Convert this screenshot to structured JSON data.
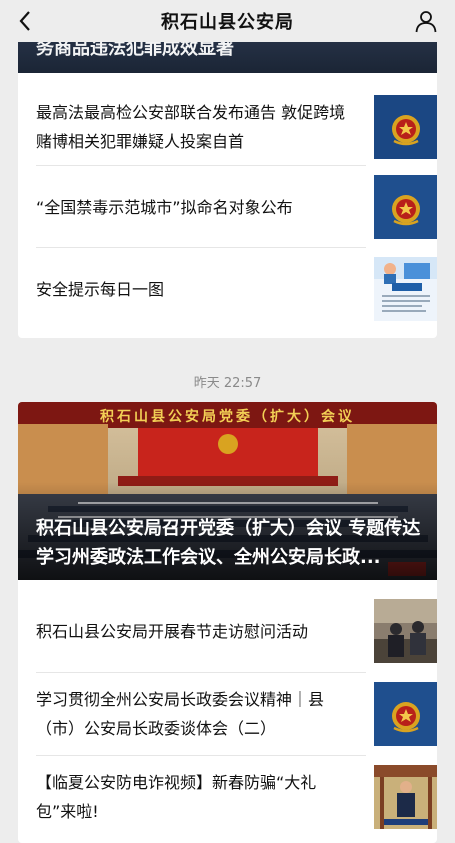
{
  "nav": {
    "title": "积石山县公安局"
  },
  "card1": {
    "hero_caption": "务商品违法犯罪成效显著",
    "items": [
      {
        "text": "最高法最高检公安部联合发布通告 敦促跨境赌博相关犯罪嫌疑人投案自首",
        "thumb": "police-emblem"
      },
      {
        "text": "“全国禁毒示范城市”拟命名对象公布",
        "thumb": "police-emblem"
      },
      {
        "text": "安全提示每日一图",
        "thumb": "safety-tip-illustration"
      }
    ]
  },
  "timestamp": "昨天 22:57",
  "card2": {
    "banner_text": "积石山县公安局党委（扩大）会议",
    "hero_caption": "积石山县公安局召开党委（扩大）会议 专题传达学习州委政法工作会议、全州公安局长政...",
    "items": [
      {
        "text": "积石山县公安局开展春节走访慰问活动",
        "thumb": "visit-photo"
      },
      {
        "text": "学习贯彻全州公安局长政委会议精神｜县（市）公安局长政委谈体会（二）",
        "thumb": "police-emblem"
      },
      {
        "text": "【临夏公安防电诈视频】新春防骗“大礼包”来啦!",
        "thumb": "video-frame"
      }
    ]
  },
  "colors": {
    "hero_dark": "#1e2a3a",
    "emblem_bg": "#1f4f8e",
    "emblem_gold": "#d9a320",
    "stage_red": "#c8241c"
  }
}
